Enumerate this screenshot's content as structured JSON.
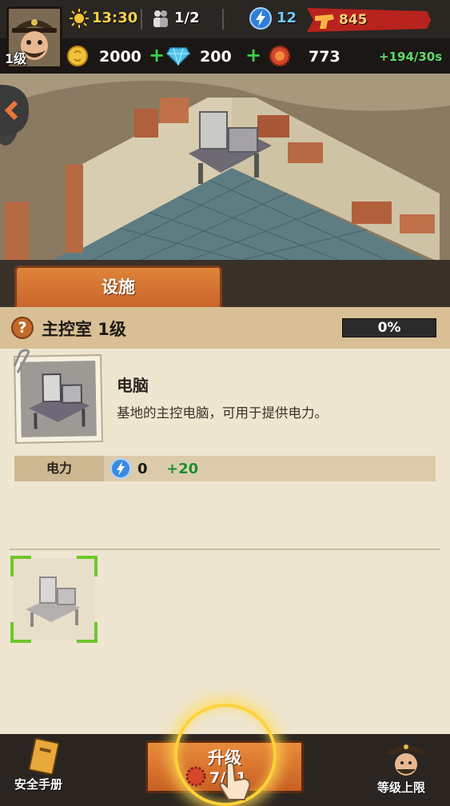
{
  "hud": {
    "level": "1级",
    "time": "13:30",
    "population": "1/2",
    "energy": "12",
    "power": "845",
    "coins": "2000",
    "diamonds": "200",
    "caps": "773",
    "rate": "+194/30s"
  },
  "tabs": [
    "设施"
  ],
  "panel": {
    "title": "主控室 1级",
    "progress": "0%",
    "item_name": "电脑",
    "item_desc": "基地的主控电脑，可用于提供电力。",
    "stat_label": "电力",
    "stat_value": "0",
    "stat_bonus": "+20"
  },
  "bottom": {
    "manual_label": "安全手册",
    "upgrade_label": "升级",
    "upgrade_cost": "7/11",
    "level_cap_label": "等级上限"
  },
  "colors": {
    "accent": "#d8743a",
    "plus_green": "#39d24a",
    "panel_bg": "#efe6d1"
  }
}
